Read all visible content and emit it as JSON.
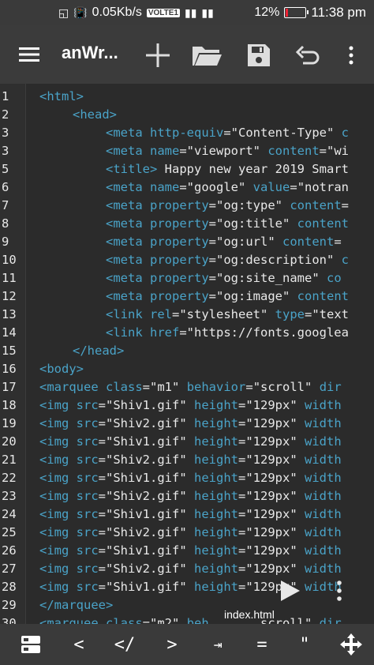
{
  "status_bar": {
    "speed": "0.05Kb/s",
    "volte": "VOLTE1",
    "battery": "12%",
    "time": "11:38 pm"
  },
  "toolbar": {
    "title": "anWr..."
  },
  "editor": {
    "file_name": "index.html",
    "lines": [
      {
        "n": "1",
        "indent": 0,
        "parts": [
          [
            "tag",
            "<html>"
          ]
        ]
      },
      {
        "n": "2",
        "indent": 1,
        "parts": [
          [
            "tag",
            "<head>"
          ]
        ]
      },
      {
        "n": "3",
        "indent": 2,
        "parts": [
          [
            "tag",
            "<meta "
          ],
          [
            "attr",
            "http-equiv"
          ],
          [
            "eq",
            "="
          ],
          [
            "str",
            "\"Content-Type\" "
          ],
          [
            "tag",
            "c"
          ]
        ]
      },
      {
        "n": "3",
        "indent": 2,
        "parts": [
          [
            "tag",
            "<meta "
          ],
          [
            "attr",
            "name"
          ],
          [
            "eq",
            "="
          ],
          [
            "str",
            "\"viewport\" "
          ],
          [
            "attr",
            "content"
          ],
          [
            "eq",
            "="
          ],
          [
            "str",
            "\"wi"
          ]
        ]
      },
      {
        "n": "5",
        "indent": 2,
        "parts": [
          [
            "tag",
            "<title>"
          ],
          [
            "txt",
            " Happy new year 2019 Smart"
          ]
        ]
      },
      {
        "n": "6",
        "indent": 2,
        "parts": [
          [
            "tag",
            "<meta "
          ],
          [
            "attr",
            "name"
          ],
          [
            "eq",
            "="
          ],
          [
            "str",
            "\"google\" "
          ],
          [
            "attr",
            "value"
          ],
          [
            "eq",
            "="
          ],
          [
            "str",
            "\"notran"
          ]
        ]
      },
      {
        "n": "7",
        "indent": 2,
        "parts": [
          [
            "tag",
            "<meta "
          ],
          [
            "attr",
            "property"
          ],
          [
            "eq",
            "="
          ],
          [
            "str",
            "\"og:type\" "
          ],
          [
            "attr",
            "content"
          ],
          [
            "eq",
            "="
          ]
        ]
      },
      {
        "n": "8",
        "indent": 2,
        "parts": [
          [
            "tag",
            "<meta "
          ],
          [
            "attr",
            "property"
          ],
          [
            "eq",
            "="
          ],
          [
            "str",
            "\"og:title\" "
          ],
          [
            "attr",
            "content"
          ]
        ]
      },
      {
        "n": "9",
        "indent": 2,
        "parts": [
          [
            "tag",
            "<meta "
          ],
          [
            "attr",
            "property"
          ],
          [
            "eq",
            "="
          ],
          [
            "str",
            "\"og:url\" "
          ],
          [
            "attr",
            "content"
          ],
          [
            "eq",
            "="
          ]
        ]
      },
      {
        "n": "10",
        "indent": 2,
        "parts": [
          [
            "tag",
            "<meta "
          ],
          [
            "attr",
            "property"
          ],
          [
            "eq",
            "="
          ],
          [
            "str",
            "\"og:description\" "
          ],
          [
            "attr",
            "c"
          ]
        ]
      },
      {
        "n": "11",
        "indent": 2,
        "parts": [
          [
            "tag",
            "<meta "
          ],
          [
            "attr",
            "property"
          ],
          [
            "eq",
            "="
          ],
          [
            "str",
            "\"og:site_name\" "
          ],
          [
            "attr",
            "co"
          ]
        ]
      },
      {
        "n": "12",
        "indent": 2,
        "parts": [
          [
            "tag",
            "<meta "
          ],
          [
            "attr",
            "property"
          ],
          [
            "eq",
            "="
          ],
          [
            "str",
            "\"og:image\" "
          ],
          [
            "attr",
            "content"
          ]
        ]
      },
      {
        "n": "13",
        "indent": 2,
        "parts": [
          [
            "tag",
            "<link "
          ],
          [
            "attr",
            "rel"
          ],
          [
            "eq",
            "="
          ],
          [
            "str",
            "\"stylesheet\" "
          ],
          [
            "attr",
            "type"
          ],
          [
            "eq",
            "="
          ],
          [
            "str",
            "\"text"
          ]
        ]
      },
      {
        "n": "14",
        "indent": 2,
        "parts": [
          [
            "tag",
            "<link "
          ],
          [
            "attr",
            "href"
          ],
          [
            "eq",
            "="
          ],
          [
            "str",
            "\"https://fonts.googlea"
          ]
        ]
      },
      {
        "n": "15",
        "indent": 1,
        "parts": [
          [
            "tag",
            "</head>"
          ]
        ]
      },
      {
        "n": "16",
        "indent": 0,
        "parts": [
          [
            "tag",
            "<body>"
          ]
        ]
      },
      {
        "n": "17",
        "indent": 0,
        "parts": [
          [
            "tag",
            "<marquee "
          ],
          [
            "attr",
            "class"
          ],
          [
            "eq",
            "="
          ],
          [
            "str",
            "\"m1\" "
          ],
          [
            "attr",
            "behavior"
          ],
          [
            "eq",
            "="
          ],
          [
            "str",
            "\"scroll\" "
          ],
          [
            "attr",
            "dir"
          ]
        ]
      },
      {
        "n": "18",
        "indent": 0,
        "parts": [
          [
            "tag",
            "<img "
          ],
          [
            "attr",
            "src"
          ],
          [
            "eq",
            "="
          ],
          [
            "str",
            "\"Shiv1.gif\" "
          ],
          [
            "attr",
            "height"
          ],
          [
            "eq",
            "="
          ],
          [
            "str",
            "\"129px\" "
          ],
          [
            "attr",
            "width"
          ]
        ]
      },
      {
        "n": "19",
        "indent": 0,
        "parts": [
          [
            "tag",
            "<img "
          ],
          [
            "attr",
            "src"
          ],
          [
            "eq",
            "="
          ],
          [
            "str",
            "\"Shiv2.gif\" "
          ],
          [
            "attr",
            "height"
          ],
          [
            "eq",
            "="
          ],
          [
            "str",
            "\"129px\" "
          ],
          [
            "attr",
            "width"
          ]
        ]
      },
      {
        "n": "20",
        "indent": 0,
        "parts": [
          [
            "tag",
            "<img "
          ],
          [
            "attr",
            "src"
          ],
          [
            "eq",
            "="
          ],
          [
            "str",
            "\"Shiv1.gif\" "
          ],
          [
            "attr",
            "height"
          ],
          [
            "eq",
            "="
          ],
          [
            "str",
            "\"129px\" "
          ],
          [
            "attr",
            "width"
          ]
        ]
      },
      {
        "n": "21",
        "indent": 0,
        "parts": [
          [
            "tag",
            "<img "
          ],
          [
            "attr",
            "src"
          ],
          [
            "eq",
            "="
          ],
          [
            "str",
            "\"Shiv2.gif\" "
          ],
          [
            "attr",
            "height"
          ],
          [
            "eq",
            "="
          ],
          [
            "str",
            "\"129px\" "
          ],
          [
            "attr",
            "width"
          ]
        ]
      },
      {
        "n": "22",
        "indent": 0,
        "parts": [
          [
            "tag",
            "<img "
          ],
          [
            "attr",
            "src"
          ],
          [
            "eq",
            "="
          ],
          [
            "str",
            "\"Shiv1.gif\" "
          ],
          [
            "attr",
            "height"
          ],
          [
            "eq",
            "="
          ],
          [
            "str",
            "\"129px\" "
          ],
          [
            "attr",
            "width"
          ]
        ]
      },
      {
        "n": "23",
        "indent": 0,
        "parts": [
          [
            "tag",
            "<img "
          ],
          [
            "attr",
            "src"
          ],
          [
            "eq",
            "="
          ],
          [
            "str",
            "\"Shiv2.gif\" "
          ],
          [
            "attr",
            "height"
          ],
          [
            "eq",
            "="
          ],
          [
            "str",
            "\"129px\" "
          ],
          [
            "attr",
            "width"
          ]
        ]
      },
      {
        "n": "24",
        "indent": 0,
        "parts": [
          [
            "tag",
            "<img "
          ],
          [
            "attr",
            "src"
          ],
          [
            "eq",
            "="
          ],
          [
            "str",
            "\"Shiv1.gif\" "
          ],
          [
            "attr",
            "height"
          ],
          [
            "eq",
            "="
          ],
          [
            "str",
            "\"129px\" "
          ],
          [
            "attr",
            "width"
          ]
        ]
      },
      {
        "n": "25",
        "indent": 0,
        "parts": [
          [
            "tag",
            "<img "
          ],
          [
            "attr",
            "src"
          ],
          [
            "eq",
            "="
          ],
          [
            "str",
            "\"Shiv2.gif\" "
          ],
          [
            "attr",
            "height"
          ],
          [
            "eq",
            "="
          ],
          [
            "str",
            "\"129px\" "
          ],
          [
            "attr",
            "width"
          ]
        ]
      },
      {
        "n": "26",
        "indent": 0,
        "parts": [
          [
            "tag",
            "<img "
          ],
          [
            "attr",
            "src"
          ],
          [
            "eq",
            "="
          ],
          [
            "str",
            "\"Shiv1.gif\" "
          ],
          [
            "attr",
            "height"
          ],
          [
            "eq",
            "="
          ],
          [
            "str",
            "\"129px\" "
          ],
          [
            "attr",
            "width"
          ]
        ]
      },
      {
        "n": "27",
        "indent": 0,
        "parts": [
          [
            "tag",
            "<img "
          ],
          [
            "attr",
            "src"
          ],
          [
            "eq",
            "="
          ],
          [
            "str",
            "\"Shiv2.gif\" "
          ],
          [
            "attr",
            "height"
          ],
          [
            "eq",
            "="
          ],
          [
            "str",
            "\"129px\" "
          ],
          [
            "attr",
            "width"
          ]
        ]
      },
      {
        "n": "28",
        "indent": 0,
        "parts": [
          [
            "tag",
            "<img "
          ],
          [
            "attr",
            "src"
          ],
          [
            "eq",
            "="
          ],
          [
            "str",
            "\"Shiv1.gif\" "
          ],
          [
            "attr",
            "height"
          ],
          [
            "eq",
            "="
          ],
          [
            "str",
            "\"129px\" "
          ],
          [
            "attr",
            "width"
          ]
        ]
      },
      {
        "n": "29",
        "indent": 0,
        "parts": [
          [
            "tag",
            "</marquee>"
          ]
        ]
      },
      {
        "n": "30",
        "indent": 0,
        "parts": [
          [
            "tag",
            "<marquee "
          ],
          [
            "attr",
            "class"
          ],
          [
            "eq",
            "="
          ],
          [
            "str",
            "\"m2\" "
          ],
          [
            "attr",
            "beh"
          ],
          [
            "str",
            "       scroll\" "
          ],
          [
            "attr",
            "dir"
          ]
        ]
      }
    ]
  },
  "bottom_bar": {
    "keys": [
      "<",
      "</",
      ">",
      "⇥",
      "=",
      "\""
    ]
  },
  "colors": {
    "tag": "#4aa3c8",
    "text": "#e8e8e8",
    "background": "#2b2b2b",
    "toolbar": "#3b3b3b"
  }
}
